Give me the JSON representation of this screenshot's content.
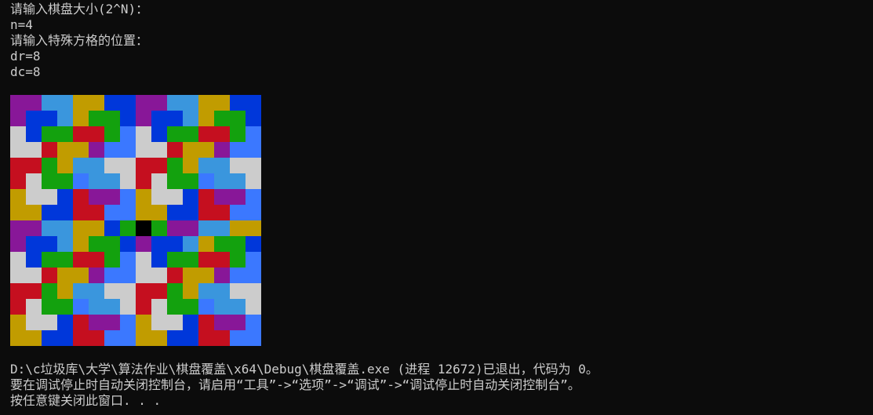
{
  "console": {
    "prompt_size": "请输入棋盘大小(2^N)：",
    "n_line": "n=4",
    "prompt_pos": "请输入特殊方格的位置：",
    "dr_line": "dr=8",
    "dc_line": "dc=8"
  },
  "board": {
    "size": 16,
    "special_row": 8,
    "special_col": 8,
    "palette": {
      "A": "#881798",
      "B": "#3a96dd",
      "C": "#13a10e",
      "D": "#c19c00",
      "E": "#0037da",
      "F": "#c50f1f",
      "G": "#cccccc",
      "H": "#3b78ff",
      "S": "#000000"
    },
    "rows": [
      "AABBDDEEAABBDDEE",
      "AEEBDCCEAEEBDCCE",
      "GECCFFCHGECCFFCH",
      "GGFDDAHHGGFDDAHH",
      "FFCDBBGGFFCDBBGG",
      "FGCCHBBGFGCCHBBG",
      "DGGEFAAHDGGEFAAH",
      "DDEEFFHHDDEEFFHH",
      "AABBDDECSCAABBDD",
      "AEEBDCCEAEEBDCCE",
      "GECCFFCHGECCFFCH",
      "GGFDDAHHGGFDDAHH",
      "FFCDBBGGFFCDBBGG",
      "FGCCHBBGFGCCHBBG",
      "DGGEFAAHDGGEFAAH",
      "DDEEFFHHDDEEFFHH"
    ]
  },
  "footer": {
    "exit_line": "D:\\c垃圾库\\大学\\算法作业\\棋盘覆盖\\x64\\Debug\\棋盘覆盖.exe (进程 12672)已退出，代码为 0。",
    "hint_line": "要在调试停止时自动关闭控制台，请启用“工具”->“选项”->“调试”->“调试停止时自动关闭控制台”。",
    "press_key_line": "按任意键关闭此窗口. . ."
  }
}
